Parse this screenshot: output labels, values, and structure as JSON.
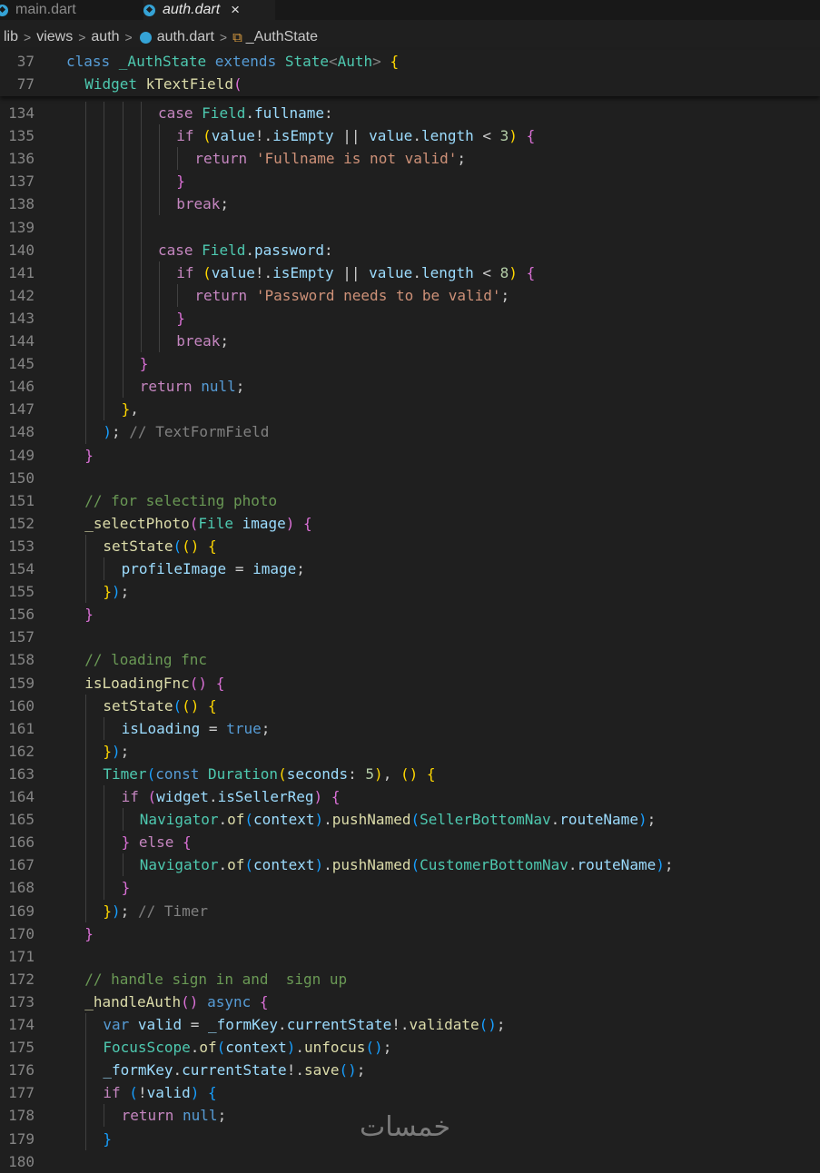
{
  "tabs": [
    {
      "label": "main.dart",
      "active": false
    },
    {
      "label": "auth.dart",
      "active": true,
      "close": "×"
    }
  ],
  "breadcrumbs": [
    "lib",
    "views",
    "auth",
    "auth.dart",
    "_AuthState"
  ],
  "sticky_lines": [
    {
      "number": "37",
      "indent": 0,
      "tokens": [
        [
          "kw",
          "class "
        ],
        [
          "ty",
          "_AuthState "
        ],
        [
          "kw",
          "extends "
        ],
        [
          "ty",
          "State"
        ],
        [
          "gr",
          "<"
        ],
        [
          "ty",
          "Auth"
        ],
        [
          "gr",
          "> "
        ],
        [
          "b1",
          "{"
        ]
      ]
    },
    {
      "number": "77",
      "indent": 1,
      "tokens": [
        [
          "ty",
          "Widget "
        ],
        [
          "fn",
          "kTextField"
        ],
        [
          "b2",
          "("
        ]
      ]
    }
  ],
  "code_lines": [
    {
      "number": "134",
      "indent": 5,
      "tokens": [
        [
          "ctl",
          "case "
        ],
        [
          "ty",
          "Field"
        ],
        [
          "",
          "."
        ],
        [
          "vr",
          "fullname"
        ],
        [
          "",
          ":"
        ]
      ]
    },
    {
      "number": "135",
      "indent": 6,
      "tokens": [
        [
          "ctl",
          "if "
        ],
        [
          "b1",
          "("
        ],
        [
          "vr",
          "value"
        ],
        [
          "",
          "!."
        ],
        [
          "vr",
          "isEmpty "
        ],
        [
          "",
          "|| "
        ],
        [
          "vr",
          "value"
        ],
        [
          "",
          "."
        ],
        [
          "vr",
          "length "
        ],
        [
          "",
          "< "
        ],
        [
          "nm",
          "3"
        ],
        [
          "b1",
          ") "
        ],
        [
          "b2",
          "{"
        ]
      ]
    },
    {
      "number": "136",
      "indent": 7,
      "tokens": [
        [
          "ctl",
          "return "
        ],
        [
          "st",
          "'Fullname is not valid'"
        ],
        [
          "",
          ";"
        ]
      ]
    },
    {
      "number": "137",
      "indent": 6,
      "tokens": [
        [
          "b2",
          "}"
        ]
      ]
    },
    {
      "number": "138",
      "indent": 6,
      "tokens": [
        [
          "ctl",
          "break"
        ],
        [
          "",
          ";"
        ]
      ]
    },
    {
      "number": "139",
      "indent": 0,
      "tokens": []
    },
    {
      "number": "140",
      "indent": 5,
      "tokens": [
        [
          "ctl",
          "case "
        ],
        [
          "ty",
          "Field"
        ],
        [
          "",
          "."
        ],
        [
          "vr",
          "password"
        ],
        [
          "",
          ":"
        ]
      ]
    },
    {
      "number": "141",
      "indent": 6,
      "tokens": [
        [
          "ctl",
          "if "
        ],
        [
          "b1",
          "("
        ],
        [
          "vr",
          "value"
        ],
        [
          "",
          "!."
        ],
        [
          "vr",
          "isEmpty "
        ],
        [
          "",
          "|| "
        ],
        [
          "vr",
          "value"
        ],
        [
          "",
          "."
        ],
        [
          "vr",
          "length "
        ],
        [
          "",
          "< "
        ],
        [
          "nm",
          "8"
        ],
        [
          "b1",
          ") "
        ],
        [
          "b2",
          "{"
        ]
      ]
    },
    {
      "number": "142",
      "indent": 7,
      "tokens": [
        [
          "ctl",
          "return "
        ],
        [
          "st",
          "'Password needs to be valid'"
        ],
        [
          "",
          ";"
        ]
      ]
    },
    {
      "number": "143",
      "indent": 6,
      "tokens": [
        [
          "b2",
          "}"
        ]
      ]
    },
    {
      "number": "144",
      "indent": 6,
      "tokens": [
        [
          "ctl",
          "break"
        ],
        [
          "",
          ";"
        ]
      ]
    },
    {
      "number": "145",
      "indent": 4,
      "tokens": [
        [
          "b2",
          "}"
        ]
      ]
    },
    {
      "number": "146",
      "indent": 4,
      "tokens": [
        [
          "ctl",
          "return "
        ],
        [
          "kw",
          "null"
        ],
        [
          "",
          ";"
        ]
      ]
    },
    {
      "number": "147",
      "indent": 3,
      "tokens": [
        [
          "b1",
          "}"
        ],
        [
          "",
          ","
        ]
      ]
    },
    {
      "number": "148",
      "indent": 2,
      "tokens": [
        [
          "b3",
          ")"
        ],
        [
          "",
          "; "
        ],
        [
          "gr",
          "// TextFormField"
        ]
      ]
    },
    {
      "number": "149",
      "indent": 1,
      "tokens": [
        [
          "b2",
          "}"
        ]
      ]
    },
    {
      "number": "150",
      "indent": 0,
      "tokens": []
    },
    {
      "number": "151",
      "indent": 1,
      "tokens": [
        [
          "cm",
          "// for selecting photo"
        ]
      ]
    },
    {
      "number": "152",
      "indent": 1,
      "tokens": [
        [
          "fn",
          "_selectPhoto"
        ],
        [
          "b2",
          "("
        ],
        [
          "ty",
          "File "
        ],
        [
          "vr",
          "image"
        ],
        [
          "b2",
          ") "
        ],
        [
          "b2",
          "{"
        ]
      ]
    },
    {
      "number": "153",
      "indent": 2,
      "tokens": [
        [
          "fn",
          "setState"
        ],
        [
          "b3",
          "("
        ],
        [
          "b1",
          "() "
        ],
        [
          "b1",
          "{"
        ]
      ]
    },
    {
      "number": "154",
      "indent": 3,
      "tokens": [
        [
          "vr",
          "profileImage "
        ],
        [
          "",
          "= "
        ],
        [
          "vr",
          "image"
        ],
        [
          "",
          ";"
        ]
      ]
    },
    {
      "number": "155",
      "indent": 2,
      "tokens": [
        [
          "b1",
          "}"
        ],
        [
          "b3",
          ")"
        ],
        [
          "",
          ";"
        ]
      ]
    },
    {
      "number": "156",
      "indent": 1,
      "tokens": [
        [
          "b2",
          "}"
        ]
      ]
    },
    {
      "number": "157",
      "indent": 0,
      "tokens": []
    },
    {
      "number": "158",
      "indent": 1,
      "tokens": [
        [
          "cm",
          "// loading fnc"
        ]
      ]
    },
    {
      "number": "159",
      "indent": 1,
      "tokens": [
        [
          "fn",
          "isLoadingFnc"
        ],
        [
          "b2",
          "() "
        ],
        [
          "b2",
          "{"
        ]
      ]
    },
    {
      "number": "160",
      "indent": 2,
      "tokens": [
        [
          "fn",
          "setState"
        ],
        [
          "b3",
          "("
        ],
        [
          "b1",
          "() "
        ],
        [
          "b1",
          "{"
        ]
      ]
    },
    {
      "number": "161",
      "indent": 3,
      "tokens": [
        [
          "vr",
          "isLoading "
        ],
        [
          "",
          "= "
        ],
        [
          "kw",
          "true"
        ],
        [
          "",
          ";"
        ]
      ]
    },
    {
      "number": "162",
      "indent": 2,
      "tokens": [
        [
          "b1",
          "}"
        ],
        [
          "b3",
          ")"
        ],
        [
          "",
          ";"
        ]
      ]
    },
    {
      "number": "163",
      "indent": 2,
      "tokens": [
        [
          "ty",
          "Timer"
        ],
        [
          "b3",
          "("
        ],
        [
          "kw",
          "const "
        ],
        [
          "ty",
          "Duration"
        ],
        [
          "b1",
          "("
        ],
        [
          "vr",
          "seconds"
        ],
        [
          "",
          ": "
        ],
        [
          "nm",
          "5"
        ],
        [
          "b1",
          ")"
        ],
        [
          "",
          ", "
        ],
        [
          "b1",
          "() "
        ],
        [
          "b1",
          "{"
        ]
      ]
    },
    {
      "number": "164",
      "indent": 3,
      "tokens": [
        [
          "ctl",
          "if "
        ],
        [
          "b2",
          "("
        ],
        [
          "vr",
          "widget"
        ],
        [
          "",
          "."
        ],
        [
          "vr",
          "isSellerReg"
        ],
        [
          "b2",
          ") "
        ],
        [
          "b2",
          "{"
        ]
      ]
    },
    {
      "number": "165",
      "indent": 4,
      "tokens": [
        [
          "ty",
          "Navigator"
        ],
        [
          "",
          "."
        ],
        [
          "fn",
          "of"
        ],
        [
          "b3",
          "("
        ],
        [
          "vr",
          "context"
        ],
        [
          "b3",
          ")"
        ],
        [
          "",
          "."
        ],
        [
          "fn",
          "pushNamed"
        ],
        [
          "b3",
          "("
        ],
        [
          "ty",
          "SellerBottomNav"
        ],
        [
          "",
          "."
        ],
        [
          "vr",
          "routeName"
        ],
        [
          "b3",
          ")"
        ],
        [
          "",
          ";"
        ]
      ]
    },
    {
      "number": "166",
      "indent": 3,
      "tokens": [
        [
          "b2",
          "} "
        ],
        [
          "ctl",
          "else "
        ],
        [
          "b2",
          "{"
        ]
      ]
    },
    {
      "number": "167",
      "indent": 4,
      "tokens": [
        [
          "ty",
          "Navigator"
        ],
        [
          "",
          "."
        ],
        [
          "fn",
          "of"
        ],
        [
          "b3",
          "("
        ],
        [
          "vr",
          "context"
        ],
        [
          "b3",
          ")"
        ],
        [
          "",
          "."
        ],
        [
          "fn",
          "pushNamed"
        ],
        [
          "b3",
          "("
        ],
        [
          "ty",
          "CustomerBottomNav"
        ],
        [
          "",
          "."
        ],
        [
          "vr",
          "routeName"
        ],
        [
          "b3",
          ")"
        ],
        [
          "",
          ";"
        ]
      ]
    },
    {
      "number": "168",
      "indent": 3,
      "tokens": [
        [
          "b2",
          "}"
        ]
      ]
    },
    {
      "number": "169",
      "indent": 2,
      "tokens": [
        [
          "b1",
          "}"
        ],
        [
          "b3",
          ")"
        ],
        [
          "",
          "; "
        ],
        [
          "gr",
          "// Timer"
        ]
      ]
    },
    {
      "number": "170",
      "indent": 1,
      "tokens": [
        [
          "b2",
          "}"
        ]
      ]
    },
    {
      "number": "171",
      "indent": 0,
      "tokens": []
    },
    {
      "number": "172",
      "indent": 1,
      "tokens": [
        [
          "cm",
          "// handle sign in and  sign up"
        ]
      ]
    },
    {
      "number": "173",
      "indent": 1,
      "tokens": [
        [
          "fn",
          "_handleAuth"
        ],
        [
          "b2",
          "() "
        ],
        [
          "kw",
          "async "
        ],
        [
          "b2",
          "{"
        ]
      ]
    },
    {
      "number": "174",
      "indent": 2,
      "tokens": [
        [
          "kw",
          "var "
        ],
        [
          "vr",
          "valid "
        ],
        [
          "",
          "= "
        ],
        [
          "vr",
          "_formKey"
        ],
        [
          "",
          "."
        ],
        [
          "vr",
          "currentState"
        ],
        [
          "",
          "!."
        ],
        [
          "fn",
          "validate"
        ],
        [
          "b3",
          "()"
        ],
        [
          "",
          ";"
        ]
      ]
    },
    {
      "number": "175",
      "indent": 2,
      "tokens": [
        [
          "ty",
          "FocusScope"
        ],
        [
          "",
          "."
        ],
        [
          "fn",
          "of"
        ],
        [
          "b3",
          "("
        ],
        [
          "vr",
          "context"
        ],
        [
          "b3",
          ")"
        ],
        [
          "",
          "."
        ],
        [
          "fn",
          "unfocus"
        ],
        [
          "b3",
          "()"
        ],
        [
          "",
          ";"
        ]
      ]
    },
    {
      "number": "176",
      "indent": 2,
      "tokens": [
        [
          "vr",
          "_formKey"
        ],
        [
          "",
          "."
        ],
        [
          "vr",
          "currentState"
        ],
        [
          "",
          "!."
        ],
        [
          "fn",
          "save"
        ],
        [
          "b3",
          "()"
        ],
        [
          "",
          ";"
        ]
      ]
    },
    {
      "number": "177",
      "indent": 2,
      "tokens": [
        [
          "ctl",
          "if "
        ],
        [
          "b3",
          "("
        ],
        [
          "",
          "!"
        ],
        [
          "vr",
          "valid"
        ],
        [
          "b3",
          ") "
        ],
        [
          "b3",
          "{"
        ]
      ]
    },
    {
      "number": "178",
      "indent": 3,
      "tokens": [
        [
          "ctl",
          "return "
        ],
        [
          "kw",
          "null"
        ],
        [
          "",
          ";"
        ]
      ]
    },
    {
      "number": "179",
      "indent": 2,
      "tokens": [
        [
          "b3",
          "}"
        ]
      ]
    },
    {
      "number": "180",
      "indent": 0,
      "tokens": []
    }
  ],
  "watermark": "خمسات"
}
